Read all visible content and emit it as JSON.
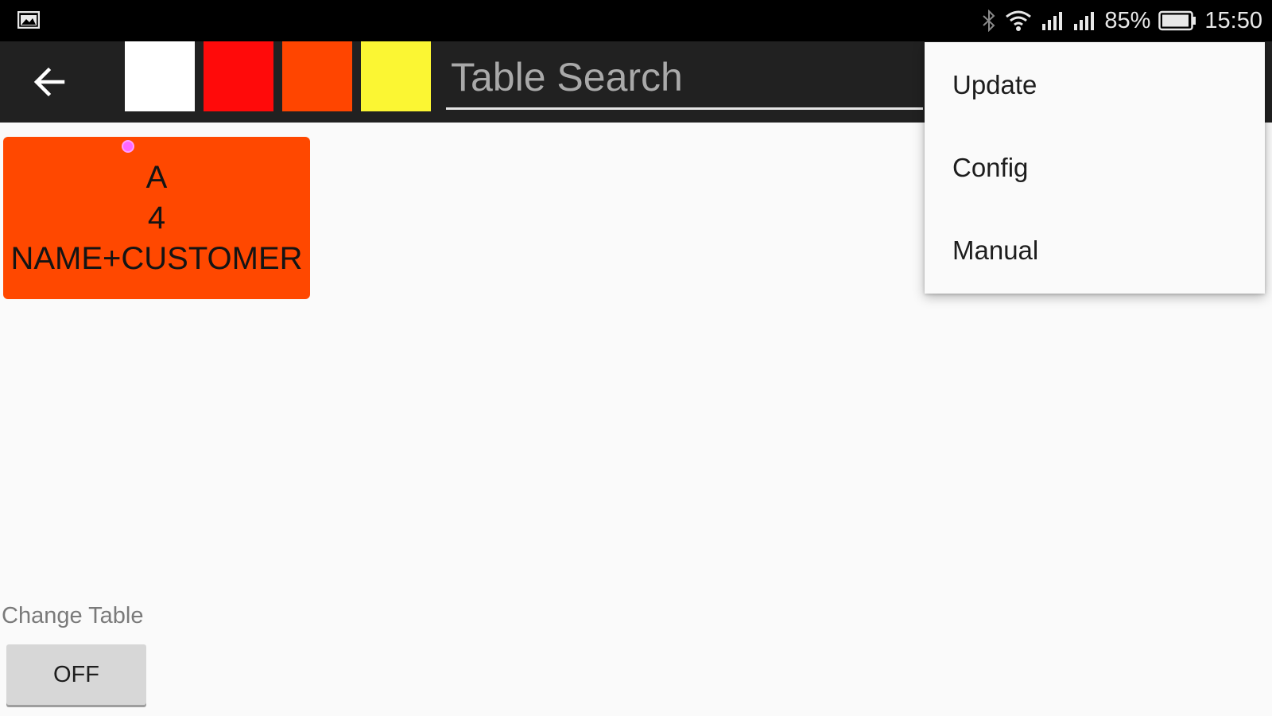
{
  "status_bar": {
    "battery": "85%",
    "time": "15:50",
    "icons": [
      "gallery-icon",
      "bluetooth-icon",
      "wifi-icon",
      "signal-icon",
      "signal-icon",
      "battery-icon"
    ]
  },
  "app_bar": {
    "back_icon": "arrow-left-icon",
    "search": {
      "placeholder": "Table Search",
      "value": ""
    },
    "color_swatches": [
      {
        "name": "white",
        "color": "#ffffff"
      },
      {
        "name": "red",
        "color": "#ff0a0a"
      },
      {
        "name": "orange",
        "color": "#ff4500"
      },
      {
        "name": "yellow",
        "color": "#fbf633"
      }
    ]
  },
  "table_card": {
    "color": "#ff4800",
    "line1": "A",
    "line2": "4",
    "line3": "NAME+CUSTOMER"
  },
  "overflow_menu": {
    "items": [
      {
        "label": "Update"
      },
      {
        "label": "Config"
      },
      {
        "label": "Manual"
      }
    ]
  },
  "change_table": {
    "label": "Change Table",
    "button_label": "OFF"
  }
}
